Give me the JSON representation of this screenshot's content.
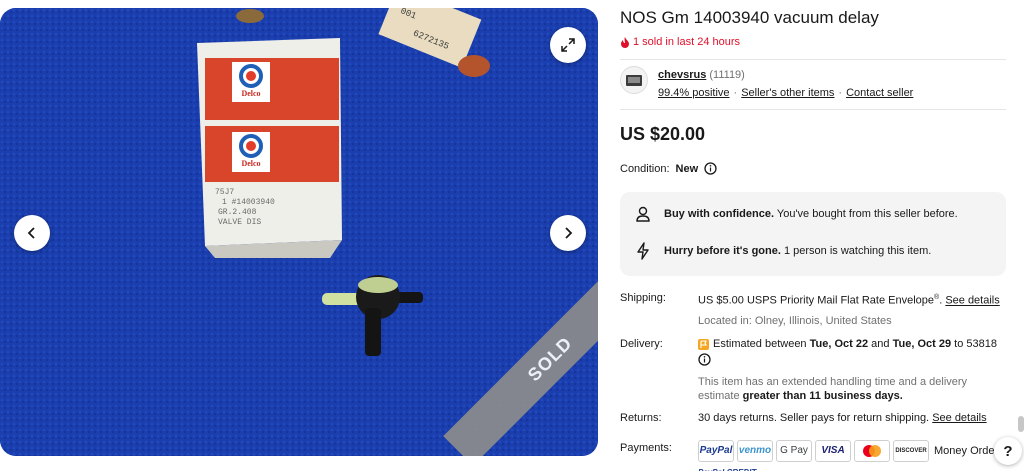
{
  "gallery": {
    "sold_label": "SOLD",
    "box_brand_top": "Delco",
    "box_brand_bottom": "Delco",
    "box_label_lines": [
      "75J7",
      "1 #14003940",
      "GR.2.408",
      "VALVE DIS"
    ],
    "tag_text": "6272135",
    "tag_text_2": "001",
    "icons": [
      "expand-icon",
      "chevron-left-icon",
      "chevron-right-icon"
    ]
  },
  "listing": {
    "title": "NOS Gm 14003940 vacuum delay",
    "sold_recent": "1 sold in last 24 hours",
    "price": "US $20.00",
    "condition_label": "Condition:",
    "condition_value": "New"
  },
  "seller": {
    "name": "chevsrus",
    "feedback_count": "(11119)",
    "positive": "99.4% positive",
    "other_items": "Seller's other items",
    "contact": "Contact seller",
    "separator": "·"
  },
  "confidence": {
    "buy_bold": "Buy with confidence.",
    "buy_text": "You've bought from this seller before.",
    "hurry_bold": "Hurry before it's gone.",
    "hurry_text": "1 person is watching this item."
  },
  "shipping": {
    "label": "Shipping:",
    "cost": "US $5.00",
    "service": "USPS Priority Mail Flat Rate Envelope",
    "service_mark": "®",
    "see_details": "See details",
    "location": "Located in: Olney, Illinois, United States"
  },
  "delivery": {
    "label": "Delivery:",
    "prefix": "Estimated between",
    "start": "Tue, Oct 22",
    "and": "and",
    "end": "Tue, Oct 29",
    "to": "to 53818",
    "note": "This item has an extended handling time and a delivery estimate",
    "note_bold": "greater than 11 business days."
  },
  "returns": {
    "label": "Returns:",
    "text": "30 days returns. Seller pays for return shipping.",
    "see_details": "See details"
  },
  "payments": {
    "label": "Payments:",
    "methods": [
      "PayPal",
      "venmo",
      "G Pay",
      "VISA",
      "",
      "DISCOVER"
    ],
    "money_order": "Money Order",
    "credit_partial": "PayPal CREDIT"
  },
  "colors": {
    "accent_red": "#e0102b",
    "text": "#191919",
    "muted": "#707070",
    "panel_bg": "#f4f4f4",
    "photo_bg": "#1b3fb0"
  },
  "help": {
    "label": "?"
  }
}
